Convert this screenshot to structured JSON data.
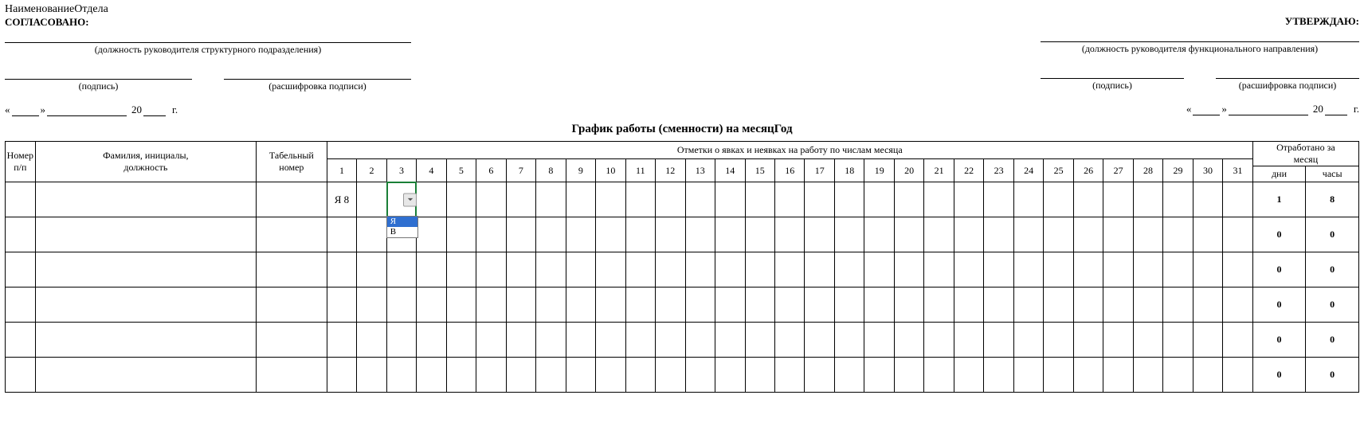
{
  "header": {
    "department_label": "НаименованиеОтдела",
    "agreed_label": "СОГЛАСОВАНО:",
    "approved_label": "УТВЕРЖДАЮ:",
    "left_position_caption": "(должность руководителя структурного подразделения)",
    "right_position_caption": "(должность руководителя функционального направления)",
    "signature_caption": "(подпись)",
    "decipher_caption": "(расшифровка подписи)",
    "date_prefix": "«",
    "date_mid": "»",
    "date_year_prefix": "20",
    "date_year_suffix": "г."
  },
  "title": "График работы (сменности) на месяцГод",
  "table": {
    "col_num": "Номер\nп/п",
    "col_name": "Фамилия, инициалы,\nдолжность",
    "col_tab": "Табельный\nномер",
    "marks_header": "Отметки о явках и неявках на работу по числам месяца",
    "worked_header": "Отработано за\nмесяц",
    "worked_days": "дни",
    "worked_hours": "часы",
    "days": [
      "1",
      "2",
      "3",
      "4",
      "5",
      "6",
      "7",
      "8",
      "9",
      "10",
      "11",
      "12",
      "13",
      "14",
      "15",
      "16",
      "17",
      "18",
      "19",
      "20",
      "21",
      "22",
      "23",
      "24",
      "25",
      "26",
      "27",
      "28",
      "29",
      "30",
      "31"
    ],
    "rows": [
      {
        "num": "",
        "name": "",
        "tab": "",
        "cells": [
          "Я 8",
          "",
          "",
          "",
          "",
          "",
          "",
          "",
          "",
          "",
          "",
          "",
          "",
          "",
          "",
          "",
          "",
          "",
          "",
          "",
          "",
          "",
          "",
          "",
          "",
          "",
          "",
          "",
          "",
          "",
          ""
        ],
        "days_total": "1",
        "hours_total": "8"
      },
      {
        "num": "",
        "name": "",
        "tab": "",
        "cells": [
          "",
          "",
          "",
          "",
          "",
          "",
          "",
          "",
          "",
          "",
          "",
          "",
          "",
          "",
          "",
          "",
          "",
          "",
          "",
          "",
          "",
          "",
          "",
          "",
          "",
          "",
          "",
          "",
          "",
          "",
          ""
        ],
        "days_total": "0",
        "hours_total": "0"
      },
      {
        "num": "",
        "name": "",
        "tab": "",
        "cells": [
          "",
          "",
          "",
          "",
          "",
          "",
          "",
          "",
          "",
          "",
          "",
          "",
          "",
          "",
          "",
          "",
          "",
          "",
          "",
          "",
          "",
          "",
          "",
          "",
          "",
          "",
          "",
          "",
          "",
          "",
          ""
        ],
        "days_total": "0",
        "hours_total": "0"
      },
      {
        "num": "",
        "name": "",
        "tab": "",
        "cells": [
          "",
          "",
          "",
          "",
          "",
          "",
          "",
          "",
          "",
          "",
          "",
          "",
          "",
          "",
          "",
          "",
          "",
          "",
          "",
          "",
          "",
          "",
          "",
          "",
          "",
          "",
          "",
          "",
          "",
          "",
          ""
        ],
        "days_total": "0",
        "hours_total": "0"
      },
      {
        "num": "",
        "name": "",
        "tab": "",
        "cells": [
          "",
          "",
          "",
          "",
          "",
          "",
          "",
          "",
          "",
          "",
          "",
          "",
          "",
          "",
          "",
          "",
          "",
          "",
          "",
          "",
          "",
          "",
          "",
          "",
          "",
          "",
          "",
          "",
          "",
          "",
          ""
        ],
        "days_total": "0",
        "hours_total": "0"
      },
      {
        "num": "",
        "name": "",
        "tab": "",
        "cells": [
          "",
          "",
          "",
          "",
          "",
          "",
          "",
          "",
          "",
          "",
          "",
          "",
          "",
          "",
          "",
          "",
          "",
          "",
          "",
          "",
          "",
          "",
          "",
          "",
          "",
          "",
          "",
          "",
          "",
          "",
          ""
        ],
        "days_total": "0",
        "hours_total": "0"
      }
    ]
  },
  "dropdown": {
    "active_row": 0,
    "active_col": 2,
    "options": [
      {
        "label": "Я",
        "selected": true
      },
      {
        "label": "В",
        "selected": false
      }
    ]
  }
}
